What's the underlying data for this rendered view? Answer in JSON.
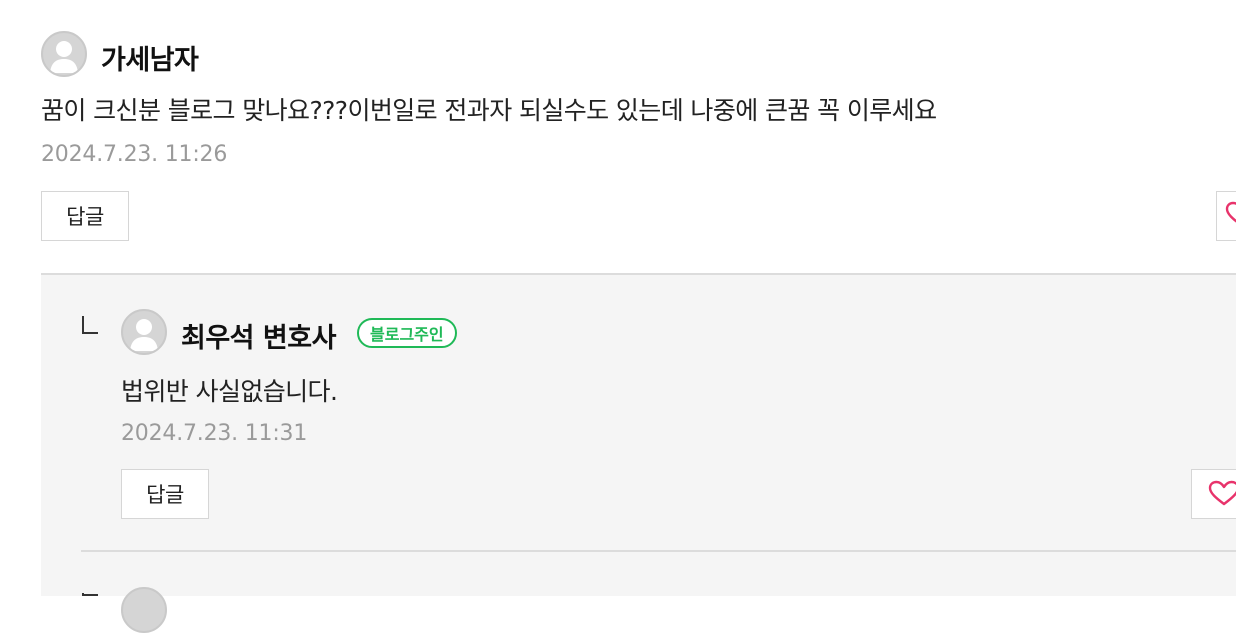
{
  "comment": {
    "author": "가세남자",
    "text": "꿈이 크신분 블로그 맞나요???이번일로 전과자 되실수도 있는데 나중에 큰꿈 꼭 이루세요",
    "timestamp": "2024.7.23. 11:26",
    "reply_button": "답글"
  },
  "reply": {
    "author": "최우석 변호사",
    "badge": "블로그주인",
    "text": "법위반 사실없습니다.",
    "timestamp": "2024.7.23. 11:31",
    "reply_button": "답글"
  },
  "colors": {
    "badge_green": "#1fb957",
    "heart_pink": "#e8336b",
    "reply_background": "#f5f5f5"
  },
  "icons": {
    "avatar": "default-avatar-icon",
    "reply_indicator": "reply-arrow-icon",
    "like": "heart-outline-icon"
  }
}
